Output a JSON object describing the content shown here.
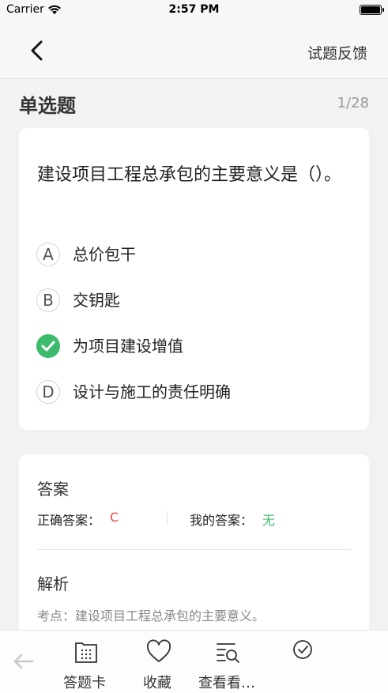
{
  "status_bar": {
    "carrier": "Carrier",
    "time": "2:57 PM"
  },
  "nav": {
    "feedback_label": "试题反馈"
  },
  "question_header": {
    "type": "单选题",
    "progress": "1/28"
  },
  "question": {
    "text": "建设项目工程总承包的主要意义是（）。",
    "options": [
      {
        "letter": "A",
        "text": "总价包干",
        "state": "normal"
      },
      {
        "letter": "B",
        "text": "交钥匙",
        "state": "normal"
      },
      {
        "letter": "C",
        "text": "为项目建设增值",
        "state": "correct"
      },
      {
        "letter": "D",
        "text": "设计与施工的责任明确",
        "state": "normal"
      }
    ]
  },
  "answer": {
    "title": "答案",
    "correct_label": "正确答案：",
    "correct_value": "C",
    "my_label": "我的答案：",
    "my_value": "无"
  },
  "analysis": {
    "title": "解析",
    "text": "考点：建设项目工程总承包的主要意义。"
  },
  "tab_bar": {
    "tabs": [
      {
        "label": "答题卡",
        "icon": "answer-card-icon"
      },
      {
        "label": "收藏",
        "icon": "heart-icon"
      },
      {
        "label": "查看看…",
        "icon": "search-list-icon"
      },
      {
        "label": "",
        "icon": "check-circle-icon"
      }
    ]
  },
  "colors": {
    "correct": "#3dbb6c",
    "wrong": "#e84a3c",
    "accent_text": "#e84a3c"
  }
}
